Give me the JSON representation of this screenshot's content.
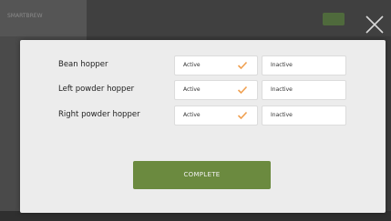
{
  "background": {
    "header_text": "SMARTBREW"
  },
  "modal": {
    "rows": [
      {
        "label": "Bean hopper",
        "active_label": "Active",
        "inactive_label": "Inactive",
        "selected": "active"
      },
      {
        "label": "Left powder hopper",
        "active_label": "Active",
        "inactive_label": "Inactive",
        "selected": "active"
      },
      {
        "label": "Right powder hopper",
        "active_label": "Active",
        "inactive_label": "Inactive",
        "selected": "active"
      }
    ],
    "complete_label": "COMPLETE"
  },
  "icons": {
    "close": "close-icon",
    "check": "checkmark-icon"
  },
  "colors": {
    "accent_green": "#6b8a3f",
    "check_orange": "#f0a050",
    "modal_bg": "#ececec",
    "overlay_bg": "#3a3a3a"
  }
}
